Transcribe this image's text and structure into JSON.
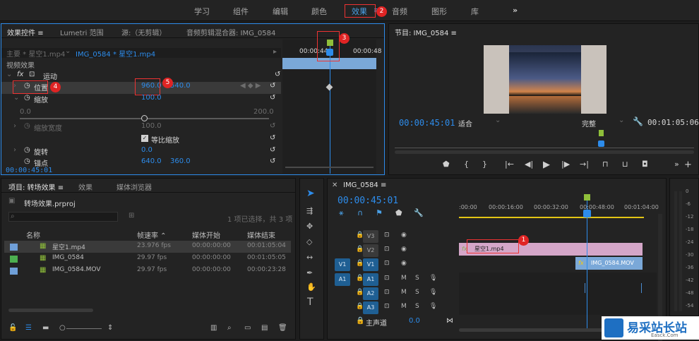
{
  "workspaces": [
    "学习",
    "组件",
    "编辑",
    "颜色",
    "效果",
    "音频",
    "图形",
    "库"
  ],
  "workspace_more": "»",
  "effects_panel": {
    "tabs": [
      "效果控件",
      "Lumetri 范围",
      "源:（无剪辑）",
      "音频剪辑混合器: IMG_0584"
    ],
    "menu_icon": "≡",
    "master_label": "主要 * 星空1.mp4",
    "sequence_label": "IMG_0584 * 星空1.mp4",
    "section": "视频效果",
    "motion": "运动",
    "position_label": "位置",
    "position_x": "960.0",
    "position_y": "540.0",
    "scale_label": "缩放",
    "scale_value": "100.0",
    "slider_min": "0.0",
    "slider_max": "200.0",
    "scale_width_label": "缩放宽度",
    "scale_width_value": "100.0",
    "uniform_label": "等比缩放",
    "uniform_checked": true,
    "rotation_label": "旋转",
    "rotation_value": "0.0",
    "anchor_label": "锚点",
    "anchor_x": "640.0",
    "anchor_y": "360.0",
    "timecode": "00:00:45:01",
    "ruler": [
      "00:00:44:",
      "00:00:48"
    ],
    "keyframe_nav": "◀ ◆ ▶"
  },
  "program": {
    "title": "节目: IMG_0584",
    "menu_icon": "≡",
    "timecode": "00:00:45:01",
    "fit": "适合",
    "quality": "完整",
    "duration": "00:01:05:06"
  },
  "project": {
    "tabs": [
      "项目: 转场效果",
      "效果",
      "媒体浏览器"
    ],
    "menu_icon": "≡",
    "file": "转场效果.prproj",
    "count": "1 项已选择，共 3 项",
    "columns": [
      "名称",
      "帧速率",
      "媒体开始",
      "媒体结束"
    ],
    "rows": [
      {
        "color": "#6f9fd8",
        "name": "星空1.mp4",
        "fps": "23.976 fps",
        "start": "00:00:00:00",
        "end": "00:01:05:04"
      },
      {
        "color": "#4caf50",
        "name": "IMG_0584",
        "fps": "29.97 fps",
        "start": "00:00:00:00",
        "end": "00:01:05:05"
      },
      {
        "color": "#6f9fd8",
        "name": "IMG_0584.MOV",
        "fps": "29.97 fps",
        "start": "00:00:00:00",
        "end": "00:00:23:28"
      }
    ]
  },
  "timeline": {
    "tab": "IMG_0584",
    "menu_icon": "≡",
    "timecode": "00:00:45:01",
    "ruler": [
      ":00:00",
      "00:00:16:00",
      "00:00:32:00",
      "00:00:48:00",
      "00:01:04:00"
    ],
    "video_tracks": [
      "V3",
      "V2",
      "V1"
    ],
    "audio_tracks": [
      "A1",
      "A2",
      "A3"
    ],
    "source_v": "V1",
    "source_a": "A1",
    "master": "主声道",
    "master_value": "0.0",
    "clip1": "星空1.mp4",
    "clip2": "IMG_0584.MOV",
    "mute": "M",
    "solo": "S"
  },
  "meter": {
    "labels": [
      "0",
      "-6",
      "-12",
      "-18",
      "-24",
      "-30",
      "-36",
      "-42",
      "-48",
      "-54"
    ]
  },
  "badges": [
    "1",
    "2",
    "3",
    "4",
    "5"
  ],
  "watermark": {
    "name": "易采站长站",
    "sub": "Easck.Com"
  },
  "colors": {
    "accent": "#2d8ceb",
    "badge": "#e02424",
    "clip_pink": "#c98ab8",
    "clip_blue": "#7aa8d8"
  }
}
